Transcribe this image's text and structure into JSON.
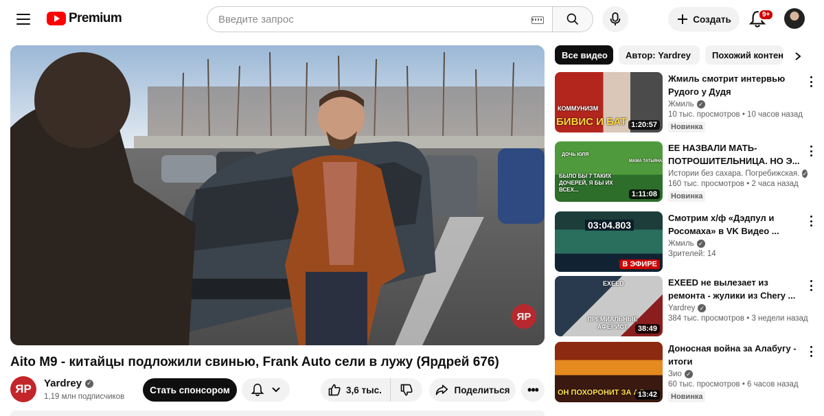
{
  "header": {
    "logo_text": "Premium",
    "search_placeholder": "Введите запрос",
    "create_label": "Создать",
    "notifications_count": "9+"
  },
  "video": {
    "title": "Aito M9 - китайцы подложили свинью, Frank Auto сели в лужу (Ярдрей 676)",
    "watermark": "ЯР"
  },
  "channel": {
    "avatar_text": "ЯР",
    "name": "Yardrey",
    "subscribers": "1,19 млн подписчиков",
    "sponsor_label": "Стать спонсором"
  },
  "actions": {
    "likes": "3,6 тыс.",
    "share_label": "Поделиться"
  },
  "filter_chips": [
    {
      "label": "Все видео",
      "active": true
    },
    {
      "label": "Автор: Yardrey",
      "active": false
    },
    {
      "label": "Похожий контент",
      "active": false
    }
  ],
  "recommendations": [
    {
      "title": "Жмиль смотрит интервью Рудого у Дудя",
      "channel": "Жмиль",
      "verified": true,
      "meta": "10 тыс. просмотров • 10 часов назад",
      "badge": "Новинка",
      "duration": "1:20:57",
      "thumb_text": "БИВИС И БАТ",
      "thumb_text2": "КОММУНИЗМ"
    },
    {
      "title": "ЕЕ НАЗВАЛИ МАТЬ-ПОТРОШИТЕЛЬНИЦА. НО Э...",
      "channel": "Истории без сахара. Погребижская.",
      "verified": true,
      "meta": "160 тыс. просмотров • 2 часа назад",
      "badge": "Новинка",
      "duration": "1:11:08",
      "thumb_text": "БЫЛО БЫ 7 ТАКИХ ДОЧЕРЕЙ, Я БЫ ИХ ВСЕХ...",
      "thumb_text2": "ДОЧЬ ЮЛЯ",
      "thumb_text3": "МАМА ТАТЬЯНА"
    },
    {
      "title": "Смотрим х/ф «Дэдпул и Росомаха» в VK Видео ...",
      "channel": "Жмиль",
      "verified": true,
      "meta": "Зрителей: 14",
      "live_label": "В ЭФИРЕ",
      "thumb_text": "03:04.803"
    },
    {
      "title": "EXEED не вылезает из ремонта - жулики из Chery ...",
      "channel": "Yardrey",
      "verified": true,
      "meta": "384 тыс. просмотров • 3 недели назад",
      "duration": "38:49",
      "thumb_text": "ПРЕМИАЛЬНЫЕ АФЕРИСТ",
      "thumb_text2": "EXEED"
    },
    {
      "title": "Доносная война за Алабугу - итоги",
      "channel": "Зио",
      "verified": true,
      "meta": "60 тыс. просмотров • 6 часов назад",
      "badge": "Новинка",
      "duration": "13:42",
      "thumb_text": "ОН ПОХОРОНИТ ЗА АЛ"
    }
  ],
  "colors": {
    "brand_red": "#ff0000",
    "channel_red": "#c3252b",
    "chip_active": "#0f0f0f",
    "chip_bg": "#f2f2f2",
    "secondary_text": "#606060"
  },
  "icons": [
    "menu-icon",
    "youtube-logo-icon",
    "keyboard-icon",
    "search-icon",
    "mic-icon",
    "plus-icon",
    "bell-icon",
    "verified-icon",
    "chevron-down-icon",
    "thumbs-up-icon",
    "thumbs-down-icon",
    "share-icon",
    "more-icon",
    "chevron-right-icon",
    "kebab-icon"
  ]
}
